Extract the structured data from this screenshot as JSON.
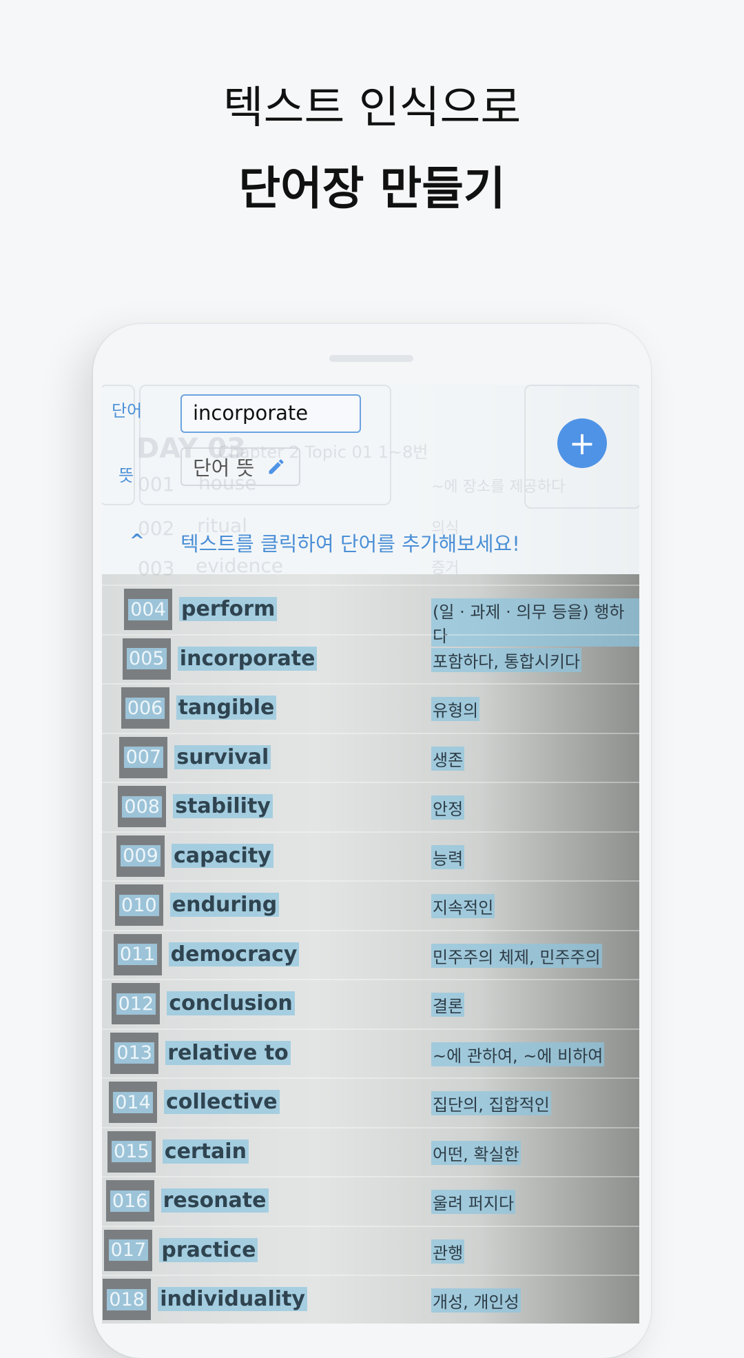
{
  "headline": {
    "line1": "텍스트 인식으로",
    "line2": "단어장 만들기"
  },
  "editor": {
    "word_label": "단어",
    "meaning_label": "뜻",
    "word_value": "incorporate",
    "meaning_placeholder": "단어 뜻",
    "edit_icon": "pencil-icon",
    "add_icon": "plus-icon",
    "hint": "텍스트를 클릭하여 단어를 추가해보세요!",
    "collapse_icon": "chevron-up-icon",
    "accent": "#4f93e6"
  },
  "background_page": {
    "heading": "DAY 03",
    "subheading": "Chapter 2 Topic 01 1~8번",
    "faded_rows": [
      {
        "num": "001",
        "word": "house",
        "meaning": "~에 장소를 제공하다"
      },
      {
        "num": "002",
        "word": "ritual",
        "meaning": "의식"
      },
      {
        "num": "003",
        "word": "evidence",
        "meaning": "증거"
      }
    ]
  },
  "rows": [
    {
      "num": "004",
      "word": "perform",
      "meaning": "(일 · 과제 · 의무 등을) 행하다"
    },
    {
      "num": "005",
      "word": "incorporate",
      "meaning": "포함하다, 통합시키다"
    },
    {
      "num": "006",
      "word": "tangible",
      "meaning": "유형의"
    },
    {
      "num": "007",
      "word": "survival",
      "meaning": "생존"
    },
    {
      "num": "008",
      "word": "stability",
      "meaning": "안정"
    },
    {
      "num": "009",
      "word": "capacity",
      "meaning": "능력"
    },
    {
      "num": "010",
      "word": "enduring",
      "meaning": "지속적인"
    },
    {
      "num": "011",
      "word": "democracy",
      "meaning": "민주주의 체제, 민주주의"
    },
    {
      "num": "012",
      "word": "conclusion",
      "meaning": "결론"
    },
    {
      "num": "013",
      "word": "relative to",
      "meaning": "~에 관하여, ~에 비하여"
    },
    {
      "num": "014",
      "word": "collective",
      "meaning": "집단의, 집합적인"
    },
    {
      "num": "015",
      "word": "certain",
      "meaning": "어떤, 확실한"
    },
    {
      "num": "016",
      "word": "resonate",
      "meaning": "울려 퍼지다"
    },
    {
      "num": "017",
      "word": "practice",
      "meaning": "관행"
    },
    {
      "num": "018",
      "word": "individuality",
      "meaning": "개성, 개인성"
    }
  ]
}
